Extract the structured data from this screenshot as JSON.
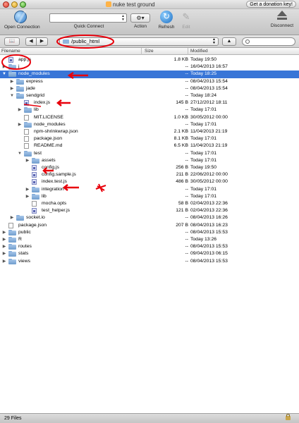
{
  "window": {
    "title": "nuke test ground",
    "donate_label": "Get a donation key!"
  },
  "toolbar": {
    "open_connection": "Open Connection",
    "quick_connect": "Quick Connect",
    "action": "Action",
    "refresh": "Refresh",
    "edit": "Edit",
    "disconnect": "Disconnect"
  },
  "pathbar": {
    "path": "/public_html",
    "search_placeholder": ""
  },
  "columns": {
    "filename": "Filename",
    "size": "Size",
    "modified": "Modified"
  },
  "files": [
    {
      "name": "app.js",
      "size": "1.8 KB",
      "modified": "Today 19:50",
      "type": "js",
      "depth": 0,
      "tri": ""
    },
    {
      "name": "j",
      "size": "--",
      "modified": "16/04/2013 16:57",
      "type": "folder",
      "depth": 0,
      "tri": "closed"
    },
    {
      "name": "node_modules",
      "size": "--",
      "modified": "Today 18:25",
      "type": "folder",
      "depth": 0,
      "tri": "open",
      "selected": true
    },
    {
      "name": "express",
      "size": "--",
      "modified": "08/04/2013 15:54",
      "type": "folder",
      "depth": 1,
      "tri": "closed"
    },
    {
      "name": "jade",
      "size": "--",
      "modified": "08/04/2013 15:54",
      "type": "folder",
      "depth": 1,
      "tri": "closed"
    },
    {
      "name": "sendgrid",
      "size": "--",
      "modified": "Today 18:24",
      "type": "folder",
      "depth": 1,
      "tri": "open"
    },
    {
      "name": "index.js",
      "size": "145 B",
      "modified": "27/12/2012 18:11",
      "type": "js",
      "depth": 2,
      "tri": ""
    },
    {
      "name": "lib",
      "size": "--",
      "modified": "Today 17:01",
      "type": "folder",
      "depth": 2,
      "tri": "closed"
    },
    {
      "name": "MIT.LICENSE",
      "size": "1.0 KB",
      "modified": "30/05/2012 00:00",
      "type": "file",
      "depth": 2,
      "tri": ""
    },
    {
      "name": "node_modules",
      "size": "--",
      "modified": "Today 17:01",
      "type": "folder",
      "depth": 2,
      "tri": "closed"
    },
    {
      "name": "npm-shrinkwrap.json",
      "size": "2.1 KB",
      "modified": "11/04/2013 21:19",
      "type": "file",
      "depth": 2,
      "tri": ""
    },
    {
      "name": "package.json",
      "size": "8.1 KB",
      "modified": "Today 17:01",
      "type": "file",
      "depth": 2,
      "tri": ""
    },
    {
      "name": "README.md",
      "size": "6.5 KB",
      "modified": "11/04/2013 21:19",
      "type": "file",
      "depth": 2,
      "tri": ""
    },
    {
      "name": "test",
      "size": "--",
      "modified": "Today 17:01",
      "type": "folder",
      "depth": 2,
      "tri": "open"
    },
    {
      "name": "assets",
      "size": "--",
      "modified": "Today 17:01",
      "type": "folder",
      "depth": 3,
      "tri": "closed"
    },
    {
      "name": "config.js",
      "size": "256 B",
      "modified": "Today 19:50",
      "type": "js",
      "depth": 3,
      "tri": ""
    },
    {
      "name": "config.sample.js",
      "size": "211 B",
      "modified": "22/06/2012 00:00",
      "type": "js",
      "depth": 3,
      "tri": ""
    },
    {
      "name": "index.test.js",
      "size": "486 B",
      "modified": "30/05/2012 00:00",
      "type": "js",
      "depth": 3,
      "tri": ""
    },
    {
      "name": "integration",
      "size": "--",
      "modified": "Today 17:01",
      "type": "folder",
      "depth": 3,
      "tri": "closed"
    },
    {
      "name": "lib",
      "size": "--",
      "modified": "Today 17:01",
      "type": "folder",
      "depth": 3,
      "tri": "closed"
    },
    {
      "name": "mocha.opts",
      "size": "58 B",
      "modified": "02/04/2013 22:36",
      "type": "file",
      "depth": 3,
      "tri": ""
    },
    {
      "name": "test_helper.js",
      "size": "121 B",
      "modified": "02/04/2013 22:36",
      "type": "js",
      "depth": 3,
      "tri": ""
    },
    {
      "name": "socket.io",
      "size": "--",
      "modified": "08/04/2013 16:26",
      "type": "folder",
      "depth": 1,
      "tri": "closed"
    },
    {
      "name": "package.json",
      "size": "207 B",
      "modified": "08/04/2013 16:23",
      "type": "file",
      "depth": 0,
      "tri": ""
    },
    {
      "name": "public",
      "size": "--",
      "modified": "08/04/2013 15:53",
      "type": "folder",
      "depth": 0,
      "tri": "closed"
    },
    {
      "name": "R",
      "size": "--",
      "modified": "Today 13:26",
      "type": "folder",
      "depth": 0,
      "tri": "closed"
    },
    {
      "name": "routes",
      "size": "--",
      "modified": "08/04/2013 15:53",
      "type": "folder",
      "depth": 0,
      "tri": "closed"
    },
    {
      "name": "stats",
      "size": "--",
      "modified": "09/04/2013 06:15",
      "type": "folder",
      "depth": 0,
      "tri": "closed"
    },
    {
      "name": "views",
      "size": "--",
      "modified": "08/04/2013 15:53",
      "type": "folder",
      "depth": 0,
      "tri": "closed"
    }
  ],
  "status": {
    "count": "29 Files"
  },
  "colors": {
    "selection": "#3875d7",
    "annotation": "#e8000b"
  }
}
